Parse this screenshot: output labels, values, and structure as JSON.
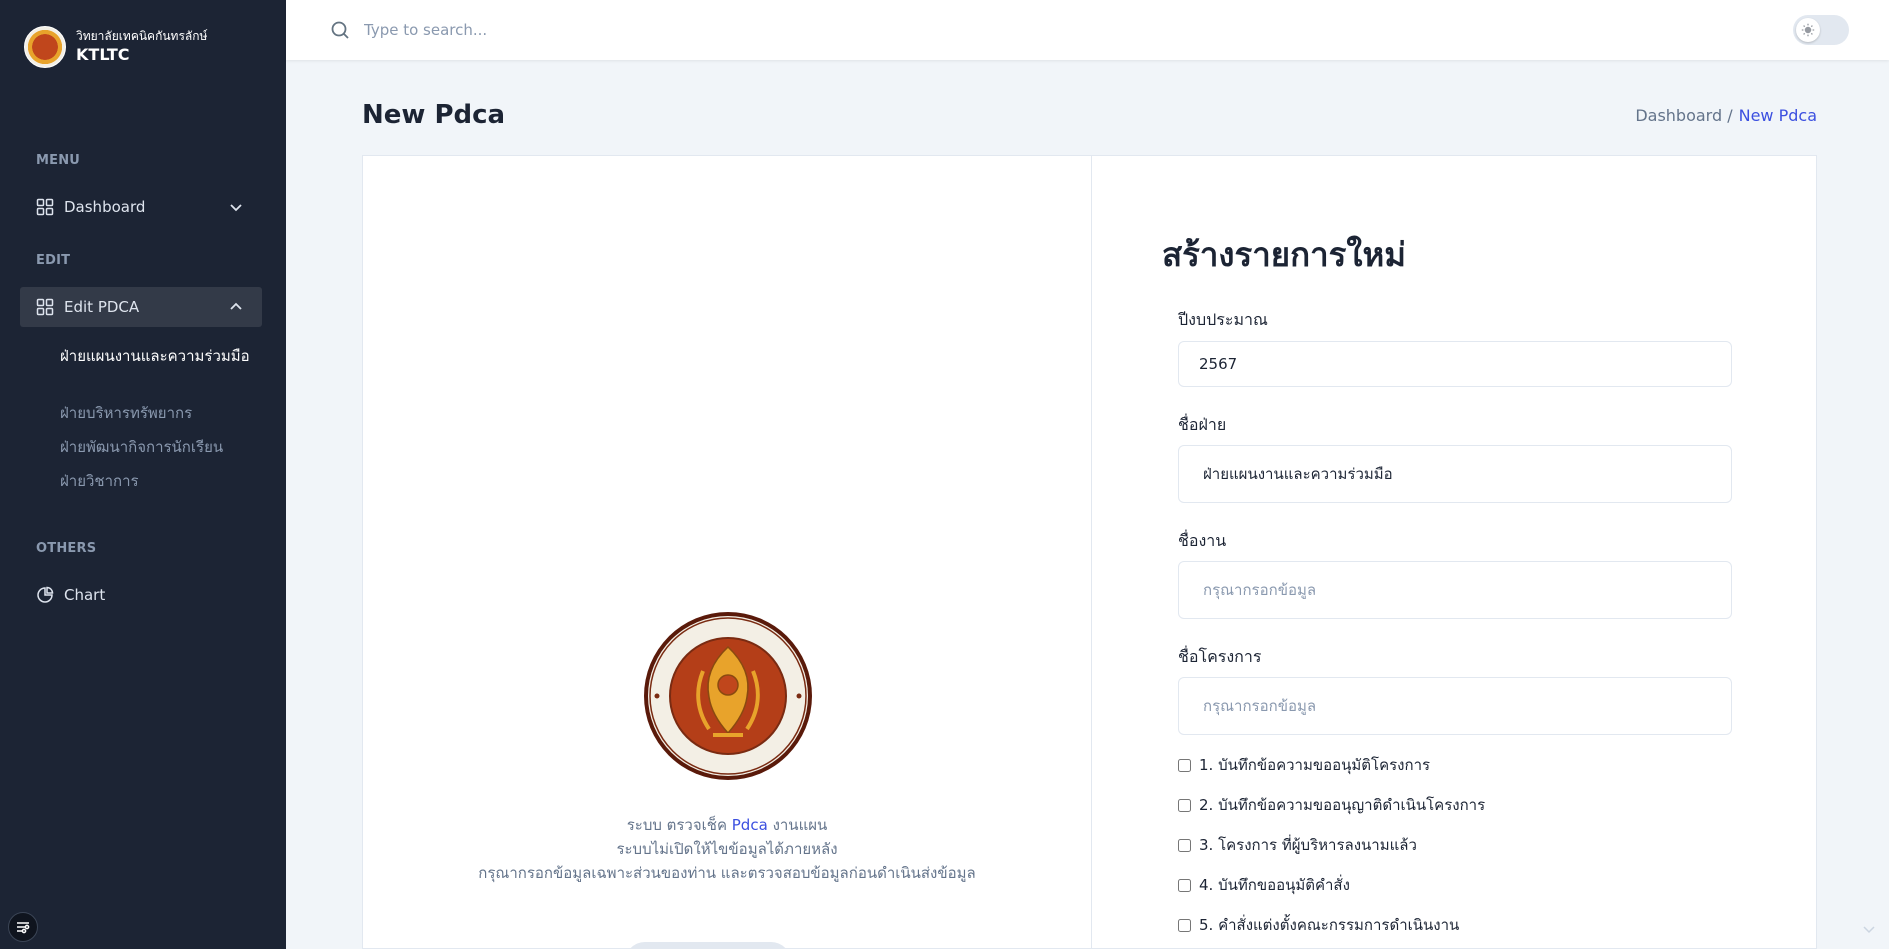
{
  "brand": {
    "name_th": "วิทยาลัยเทคนิคกันทรลักษ์",
    "name_en": "KTLTC"
  },
  "sidebar": {
    "group_menu": "MENU",
    "dashboard_label": "Dashboard",
    "group_edit": "EDIT",
    "edit_pdca_label": "Edit PDCA",
    "sub_items": [
      {
        "label": "ฝ่ายแผนงานและความร่วมมือ",
        "active": true
      },
      {
        "label": "ฝ่ายบริหารทรัพยากร",
        "active": false
      },
      {
        "label": "ฝ่ายพัฒนากิจการนักเรียน",
        "active": false
      },
      {
        "label": "ฝ่ายวิชาการ",
        "active": false
      }
    ],
    "group_others": "OTHERS",
    "chart_label": "Chart"
  },
  "header": {
    "search_placeholder": "Type to search..."
  },
  "page": {
    "title": "New Pdca",
    "breadcrumb": {
      "parent": "Dashboard /",
      "current": "New Pdca"
    }
  },
  "left_panel": {
    "line1_prefix": "ระบบ ตรวจเช็ค",
    "line1_highlight": "Pdca",
    "line1_suffix": "งานแผน",
    "line2": "ระบบไม่เปิดให้ไขข้อมูลได้ภายหลัง",
    "line3": "กรุณากรอกข้อมูลเฉพาะส่วนของท่าน และตรวจสอบข้อมูลก่อนดำเนินส่งข้อมูล"
  },
  "form": {
    "title": "สร้างรายการใหม่",
    "budget_year": {
      "label": "ปีงบประมาณ",
      "value": "2567"
    },
    "department": {
      "label": "ชื่อฝ่าย",
      "value": "ฝ่ายแผนงานและความร่วมมือ"
    },
    "task_name": {
      "label": "ชื่องาน",
      "placeholder": "กรุณากรอกข้อมูล"
    },
    "project_name": {
      "label": "ชื่อโครงการ",
      "placeholder": "กรุณากรอกข้อมูล"
    },
    "checklist": [
      {
        "label": "1. บันทึกข้อความขออนุมัติโครงการ",
        "checked": false
      },
      {
        "label": "2. บันทึกข้อความขออนุญาติดำเนินโครงการ",
        "checked": false
      },
      {
        "label": "3. โครงการ ที่ผู้บริหารลงนามแล้ว",
        "checked": false
      },
      {
        "label": "4. บันทึกขออนุมัติคำสั่ง",
        "checked": false
      },
      {
        "label": "5. คำสั่งแต่งตั้งคณะกรรมการดำเนินงาน",
        "checked": false
      }
    ]
  },
  "colors": {
    "sidebar_bg": "#1c2434",
    "accent": "#3c50e0",
    "page_bg": "#f1f5f9"
  }
}
